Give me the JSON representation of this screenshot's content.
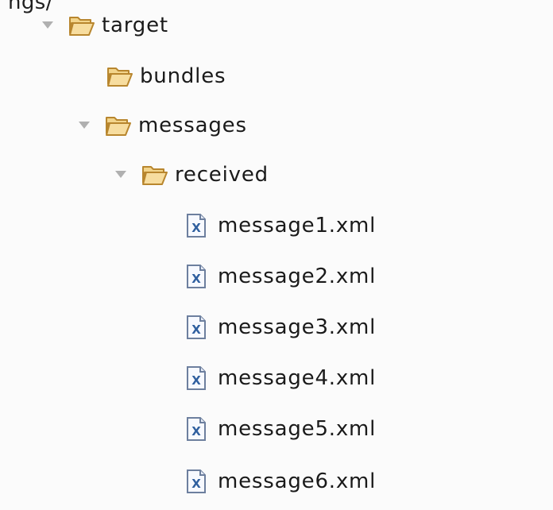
{
  "partial_top_text": "ngs/",
  "tree": {
    "target": {
      "label": "target",
      "expanded": true,
      "icon": "folder-open-icon"
    },
    "bundles": {
      "label": "bundles",
      "expanded": false,
      "icon": "folder-open-icon"
    },
    "messages": {
      "label": "messages",
      "expanded": true,
      "icon": "folder-open-icon"
    },
    "received": {
      "label": "received",
      "expanded": true,
      "icon": "folder-open-icon"
    },
    "files": [
      {
        "label": "message1.xml",
        "icon": "xml-file-icon"
      },
      {
        "label": "message2.xml",
        "icon": "xml-file-icon"
      },
      {
        "label": "message3.xml",
        "icon": "xml-file-icon"
      },
      {
        "label": "message4.xml",
        "icon": "xml-file-icon"
      },
      {
        "label": "message5.xml",
        "icon": "xml-file-icon"
      },
      {
        "label": "message6.xml",
        "icon": "xml-file-icon"
      }
    ]
  },
  "colors": {
    "folder_fill": "#f6d58a",
    "folder_stroke": "#b8862e",
    "file_blue": "#2f5f9f",
    "twisty": "#a9a9a9"
  }
}
